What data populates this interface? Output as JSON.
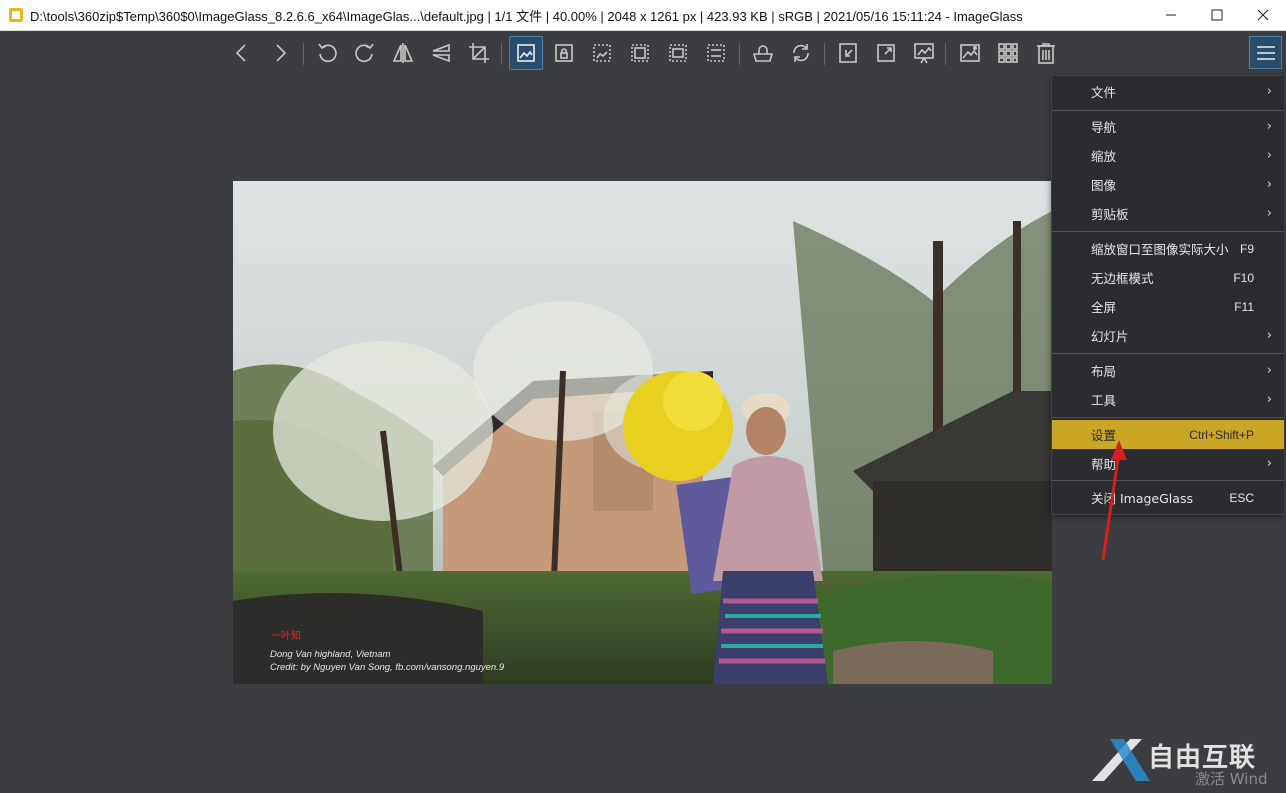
{
  "window": {
    "title": "D:\\tools\\360zip$Temp\\360$0\\ImageGlass_8.2.6.6_x64\\ImageGlas...\\default.jpg  |  1/1 文件  |  40.00%  |  2048 x 1261 px  |  423.93 KB  |  sRGB  |  2021/05/16 15:11:24  - ImageGlass",
    "controls": [
      "minimize",
      "maximize",
      "close"
    ]
  },
  "toolbar": {
    "icons": [
      "back-icon",
      "forward-icon",
      "rotate-left-icon",
      "rotate-right-icon",
      "flip-horizontal-icon",
      "flip-vertical-icon",
      "crop-icon",
      "auto-zoom-icon",
      "lock-zoom-icon",
      "scale-to-width-icon",
      "scale-to-height-icon",
      "scale-to-fit-icon",
      "scale-to-fill-icon",
      "open-with-icon",
      "refresh-icon",
      "goto-icon",
      "full-screen-icon",
      "slideshow-icon",
      "set-wallpaper-icon",
      "thumbnail-icon",
      "delete-icon",
      "main-menu-icon"
    ]
  },
  "photo": {
    "caption_line1": "Dong Van highland, Vietnam",
    "caption_line2": "Credit: by Nguyen Van Song, fb.com/vansong.nguyen.9",
    "signature": "一叶知"
  },
  "menu": {
    "items": [
      {
        "label": "文件",
        "submenu": true
      },
      {
        "label": "导航",
        "submenu": true
      },
      {
        "label": "缩放",
        "submenu": true
      },
      {
        "label": "图像",
        "submenu": true
      },
      {
        "label": "剪贴板",
        "submenu": true
      },
      {
        "label": "缩放窗口至图像实际大小",
        "shortcut": "F9"
      },
      {
        "label": "无边框模式",
        "shortcut": "F10"
      },
      {
        "label": "全屏",
        "shortcut": "F11"
      },
      {
        "label": "幻灯片",
        "submenu": true
      },
      {
        "label": "布局",
        "submenu": true
      },
      {
        "label": "工具",
        "submenu": true
      },
      {
        "label": "设置",
        "shortcut": "Ctrl+Shift+P",
        "highlighted": true
      },
      {
        "label": "帮助",
        "submenu": true
      },
      {
        "label": "关闭 ImageGlass",
        "shortcut": "ESC"
      }
    ]
  },
  "watermark": {
    "text": "自由互联",
    "sub": "激活 Wind"
  },
  "colors": {
    "background": "#3c3d40",
    "menu_bg": "#2b2c2f",
    "highlight": "#c9a623",
    "active_tool": "#2a4c6b",
    "annotation": "#d42020"
  }
}
